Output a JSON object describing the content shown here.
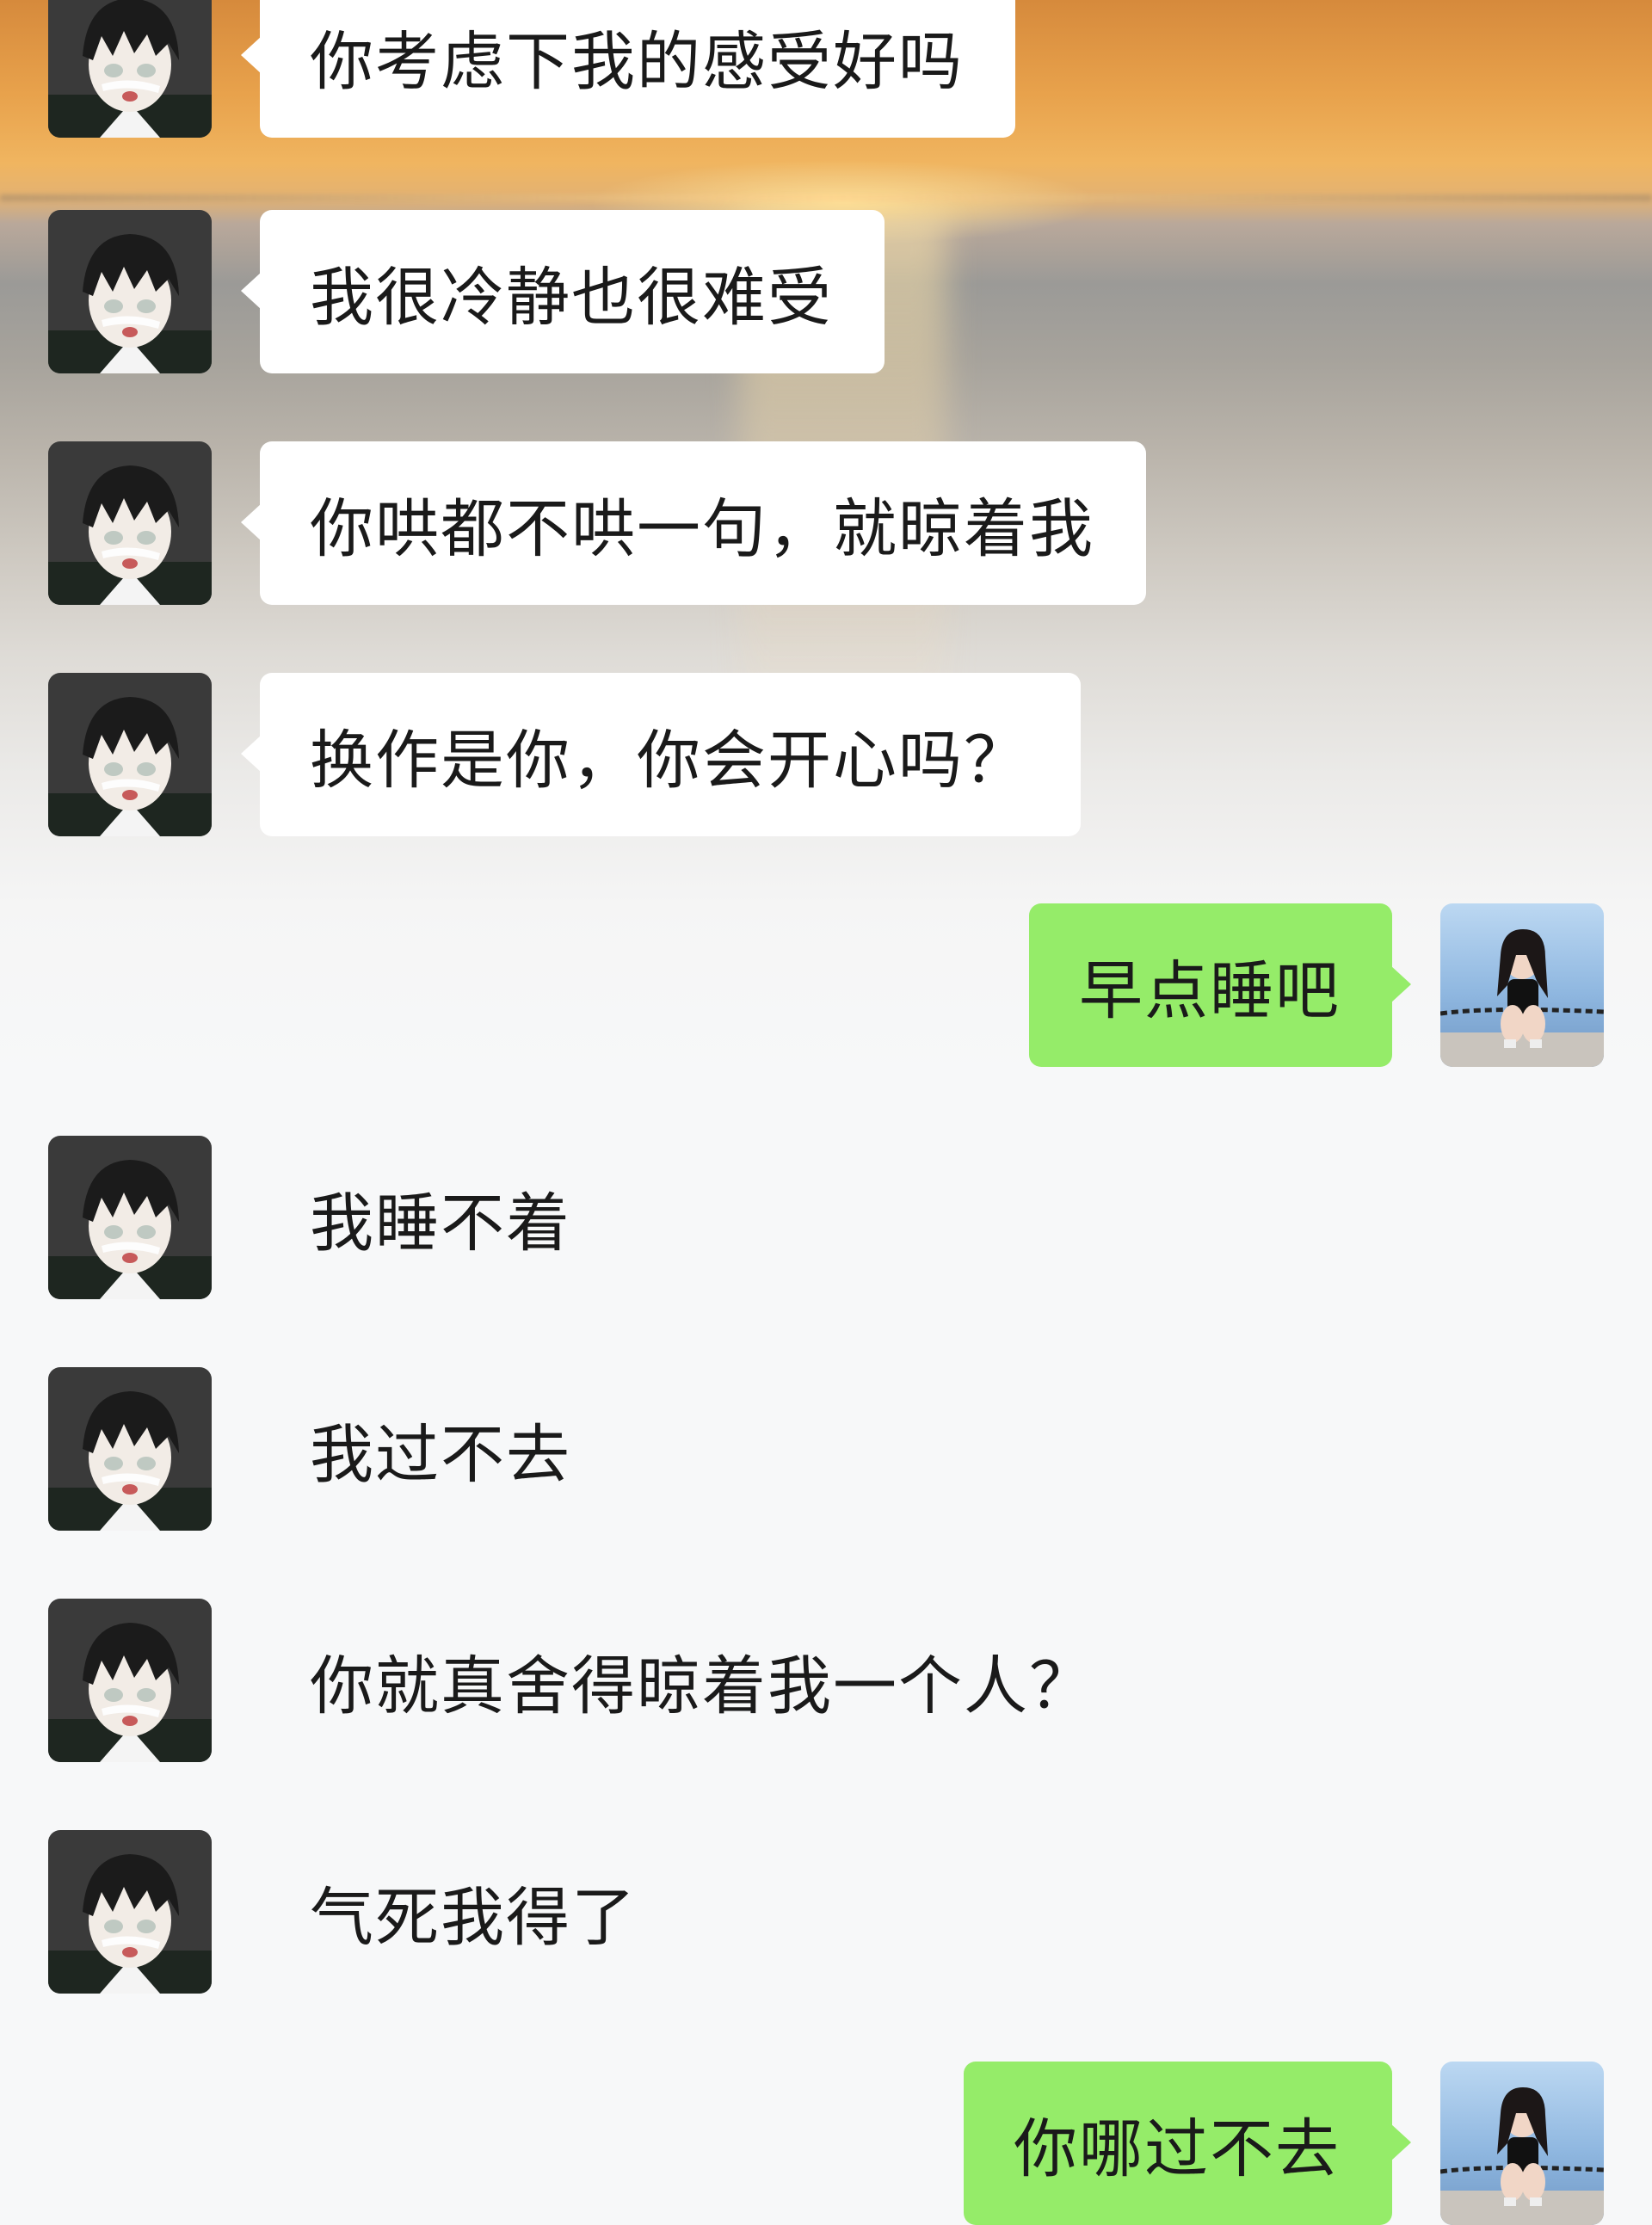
{
  "chat": {
    "messages": [
      {
        "sender": "other",
        "text": "你考虑下我的感受好吗"
      },
      {
        "sender": "other",
        "text": "我很冷静也很难受"
      },
      {
        "sender": "other",
        "text": "你哄都不哄一句，就晾着我"
      },
      {
        "sender": "other",
        "text": "换作是你，你会开心吗？"
      },
      {
        "sender": "me",
        "text": "早点睡吧"
      },
      {
        "sender": "other",
        "text": "我睡不着"
      },
      {
        "sender": "other",
        "text": "我过不去"
      },
      {
        "sender": "other",
        "text": "你就真舍得晾着我一个人？"
      },
      {
        "sender": "other",
        "text": "气死我得了"
      },
      {
        "sender": "me",
        "text": "你哪过不去"
      }
    ]
  },
  "colors": {
    "incoming_bubble": "#ffffff",
    "outgoing_bubble": "#95ec69",
    "text": "#1a1a1a"
  },
  "icons": {
    "other_avatar": "anime-boy-avatar-icon",
    "my_avatar": "girl-photo-avatar-icon"
  }
}
